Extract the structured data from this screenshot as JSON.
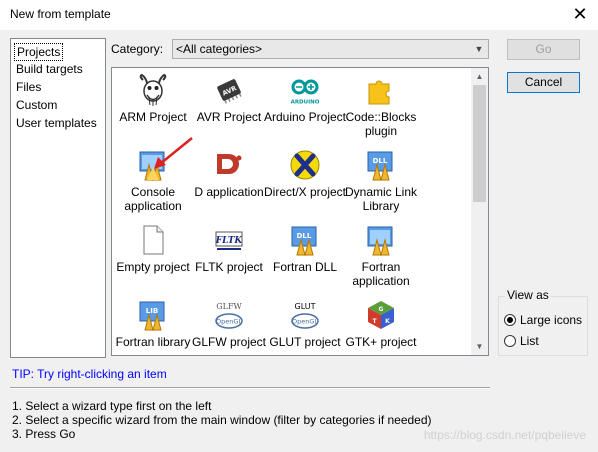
{
  "window": {
    "title": "New from template"
  },
  "categories_list": {
    "items": [
      "Projects",
      "Build targets",
      "Files",
      "Custom",
      "User templates"
    ],
    "selected_index": 0
  },
  "category_filter": {
    "label": "Category:",
    "value": "<All categories>"
  },
  "buttons": {
    "go": "Go",
    "cancel": "Cancel"
  },
  "wizards": [
    {
      "label": "ARM Project",
      "icon": "gnu-gnome-icon"
    },
    {
      "label": "AVR Project",
      "icon": "avr-chip-icon"
    },
    {
      "label": "Arduino Project",
      "icon": "arduino-logo-icon"
    },
    {
      "label": "Code::Blocks plugin",
      "icon": "puzzle-piece-icon"
    },
    {
      "label": "Console application",
      "icon": "console-shell-icon"
    },
    {
      "label": "D application",
      "icon": "d-language-icon"
    },
    {
      "label": "Direct/X project",
      "icon": "directx-icon"
    },
    {
      "label": "Dynamic Link Library",
      "icon": "dll-shell-icon"
    },
    {
      "label": "Empty project",
      "icon": "blank-page-icon"
    },
    {
      "label": "FLTK project",
      "icon": "fltk-icon"
    },
    {
      "label": "Fortran DLL",
      "icon": "fortran-dll-icon"
    },
    {
      "label": "Fortran application",
      "icon": "fortran-app-icon"
    },
    {
      "label": "Fortran library",
      "icon": "fortran-lib-icon"
    },
    {
      "label": "GLFW project",
      "icon": "glfw-opengl-icon"
    },
    {
      "label": "GLUT project",
      "icon": "glut-opengl-icon"
    },
    {
      "label": "GTK+ project",
      "icon": "gtk-cube-icon"
    }
  ],
  "view_as": {
    "legend": "View as",
    "options": [
      "Large icons",
      "List"
    ],
    "selected": "Large icons"
  },
  "tip": "TIP: Try right-clicking an item",
  "steps": [
    "1. Select a wizard type first on the left",
    "2. Select a specific wizard from the main window (filter by categories if needed)",
    "3. Press Go"
  ],
  "watermark": "https://blog.csdn.net/pqbelieve",
  "colors": {
    "tip": "#0000ff",
    "accent": "#0078d7",
    "annotation_arrow": "#e02020"
  }
}
